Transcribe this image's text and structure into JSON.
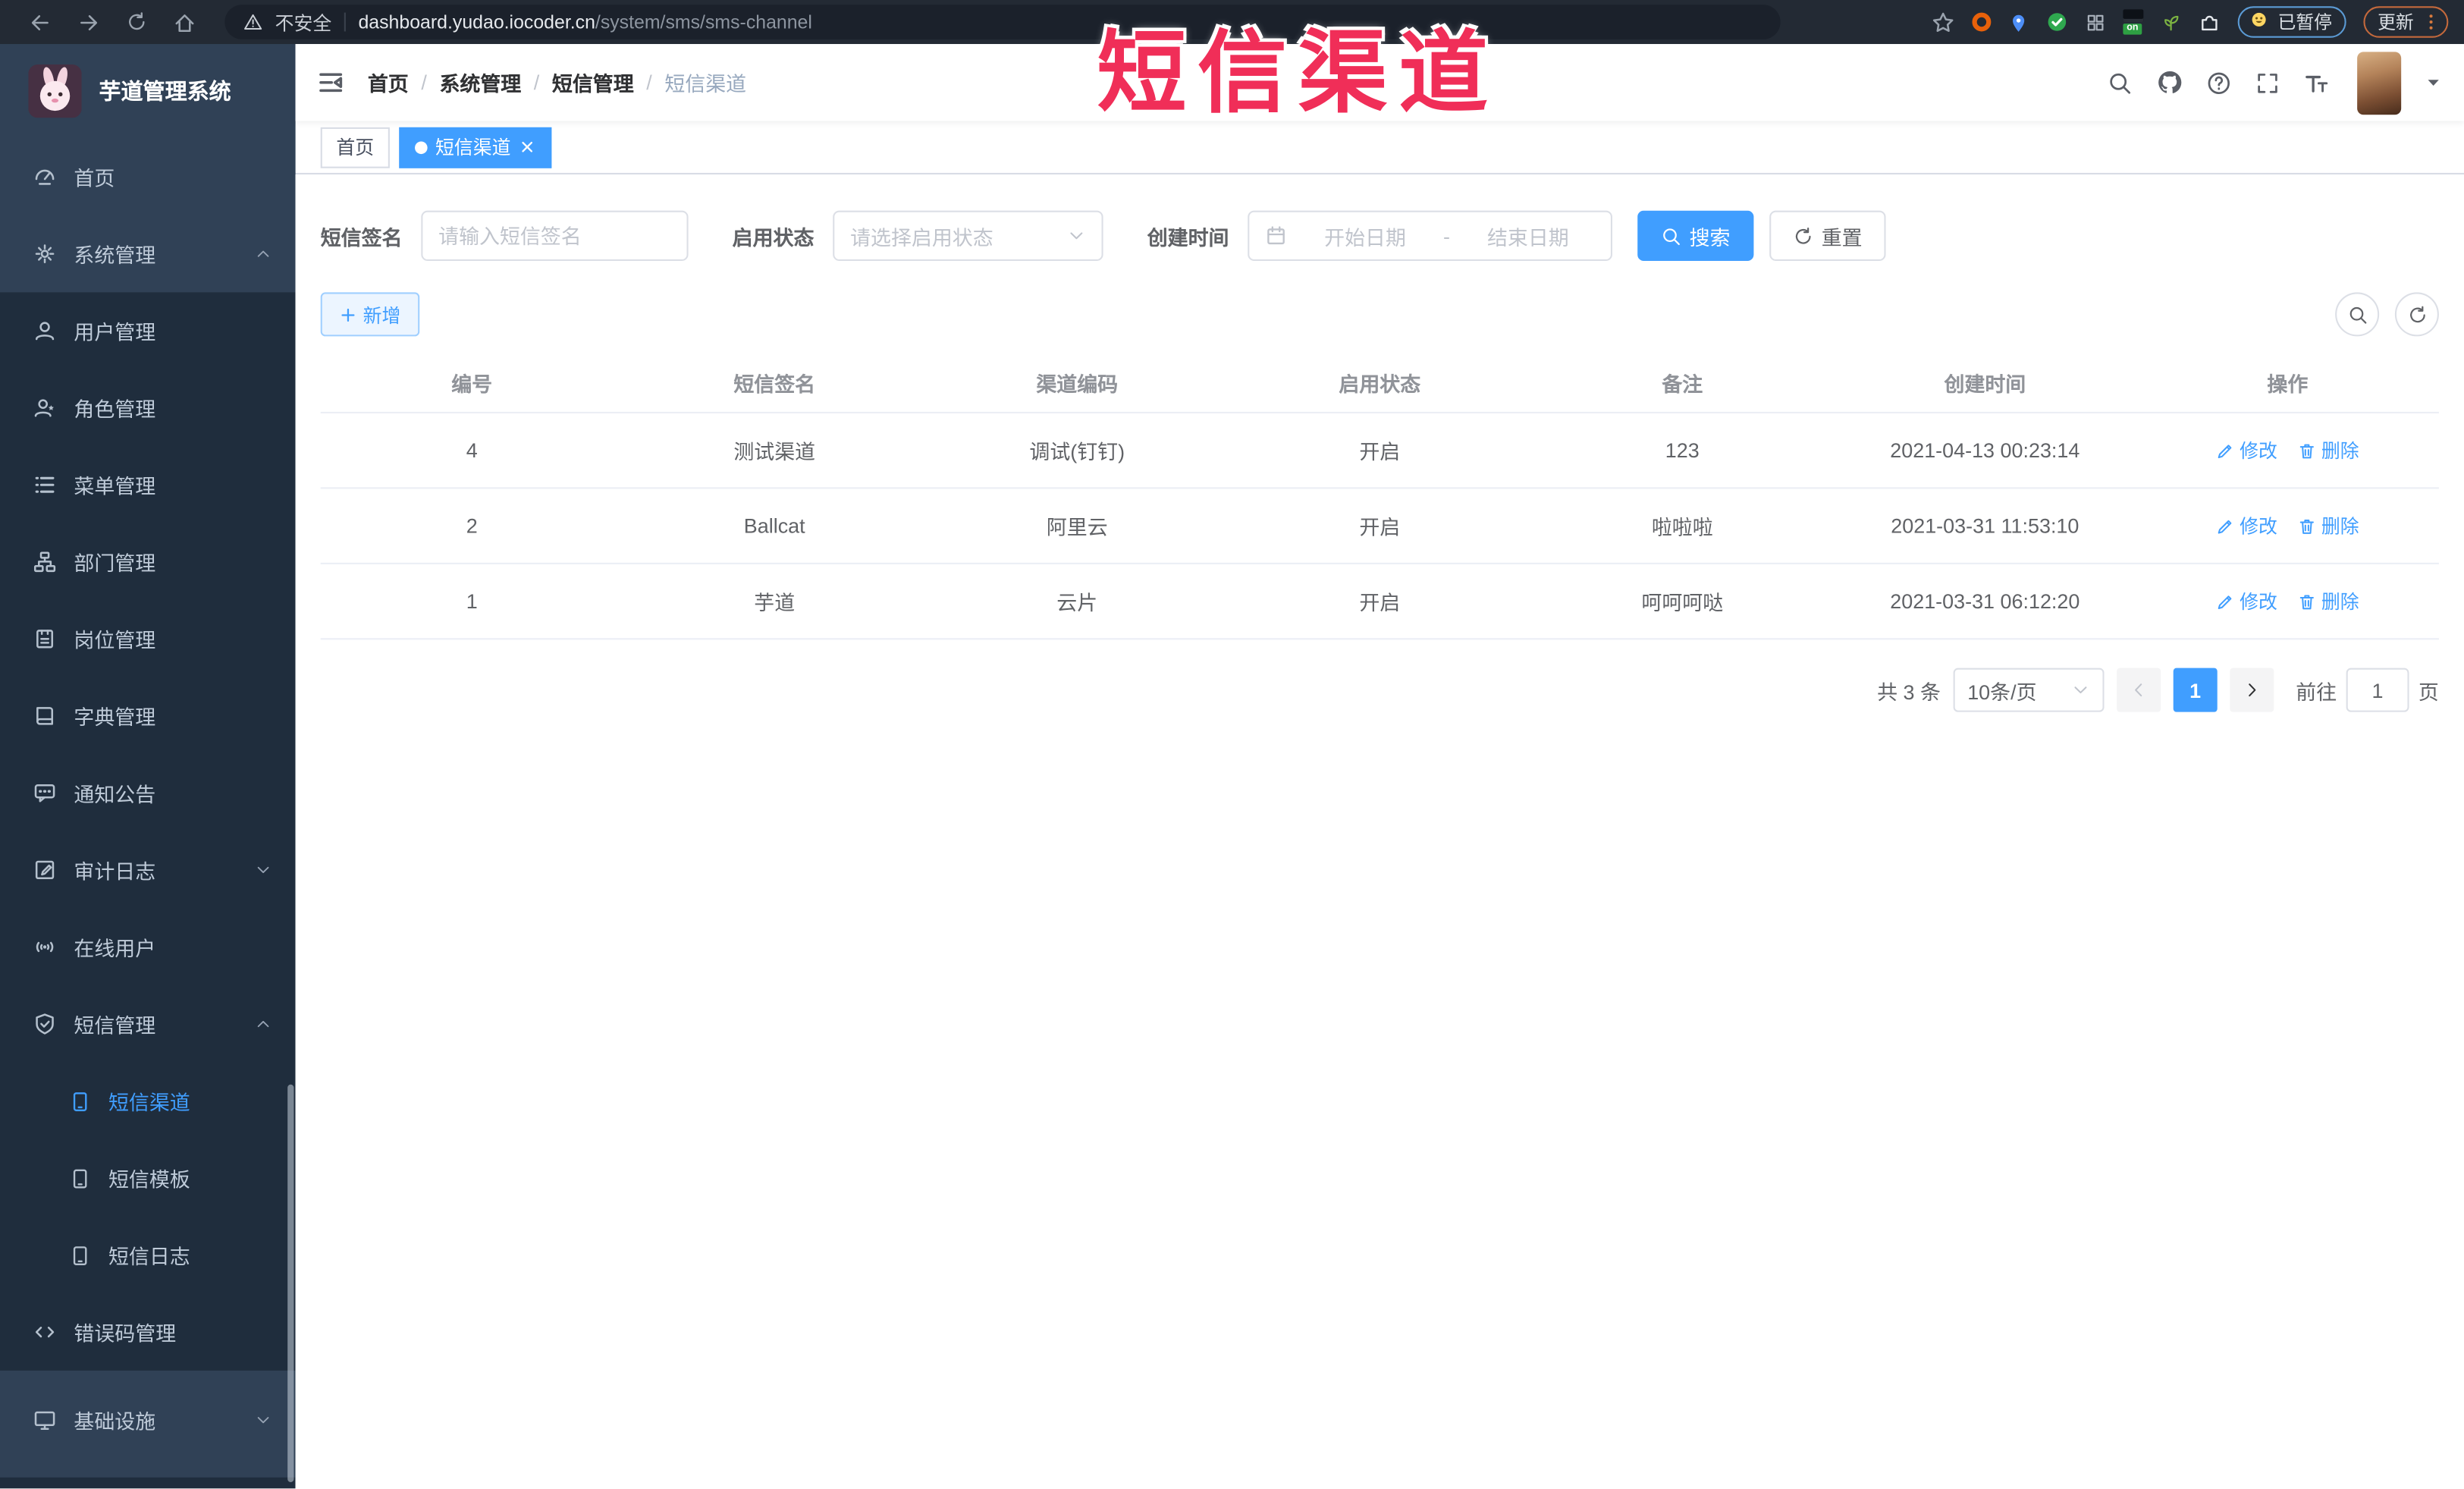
{
  "browser": {
    "security_label": "不安全",
    "url_host": "dashboard.yudao.iocoder.cn",
    "url_path": "/system/sms/sms-channel",
    "extension_on_badge": "on",
    "paused_badge_label": "已暂停",
    "update_button_label": "更新"
  },
  "watermark": {
    "text": "短信渠道"
  },
  "sidebar": {
    "app_title": "芋道管理系统",
    "items": [
      {
        "label": "首页"
      },
      {
        "label": "系统管理"
      },
      {
        "label": "用户管理"
      },
      {
        "label": "角色管理"
      },
      {
        "label": "菜单管理"
      },
      {
        "label": "部门管理"
      },
      {
        "label": "岗位管理"
      },
      {
        "label": "字典管理"
      },
      {
        "label": "通知公告"
      },
      {
        "label": "审计日志"
      },
      {
        "label": "在线用户"
      },
      {
        "label": "短信管理"
      },
      {
        "label": "短信渠道"
      },
      {
        "label": "短信模板"
      },
      {
        "label": "短信日志"
      },
      {
        "label": "错误码管理"
      },
      {
        "label": "基础设施"
      }
    ]
  },
  "header": {
    "breadcrumb": [
      "首页",
      "系统管理",
      "短信管理",
      "短信渠道"
    ]
  },
  "tabs": [
    {
      "label": "首页"
    },
    {
      "label": "短信渠道"
    }
  ],
  "filters": {
    "sign_label": "短信签名",
    "sign_placeholder": "请输入短信签名",
    "status_label": "启用状态",
    "status_placeholder": "请选择启用状态",
    "date_label": "创建时间",
    "date_start_placeholder": "开始日期",
    "date_separator": "-",
    "date_end_placeholder": "结束日期",
    "search_label": "搜索",
    "reset_label": "重置"
  },
  "toolbar": {
    "add_label": "新增"
  },
  "table": {
    "columns": [
      "编号",
      "短信签名",
      "渠道编码",
      "启用状态",
      "备注",
      "创建时间",
      "操作"
    ],
    "op_edit": "修改",
    "op_delete": "删除",
    "rows": [
      {
        "id": "4",
        "sign": "测试渠道",
        "code": "调试(钉钉)",
        "status": "开启",
        "remark": "123",
        "created": "2021-04-13 00:23:14"
      },
      {
        "id": "2",
        "sign": "Ballcat",
        "code": "阿里云",
        "status": "开启",
        "remark": "啦啦啦",
        "created": "2021-03-31 11:53:10"
      },
      {
        "id": "1",
        "sign": "芋道",
        "code": "云片",
        "status": "开启",
        "remark": "呵呵呵哒",
        "created": "2021-03-31 06:12:20"
      }
    ]
  },
  "pagination": {
    "total_label": "共 3 条",
    "page_size_label": "10条/页",
    "current_page": "1",
    "goto_label": "前往",
    "goto_value": "1",
    "page_unit_label": "页"
  },
  "colors": {
    "accent": "#409EFF",
    "sidebar_bg": "#304156",
    "submenu_bg": "#1f2d3d",
    "watermark_red": "#f02e58"
  }
}
